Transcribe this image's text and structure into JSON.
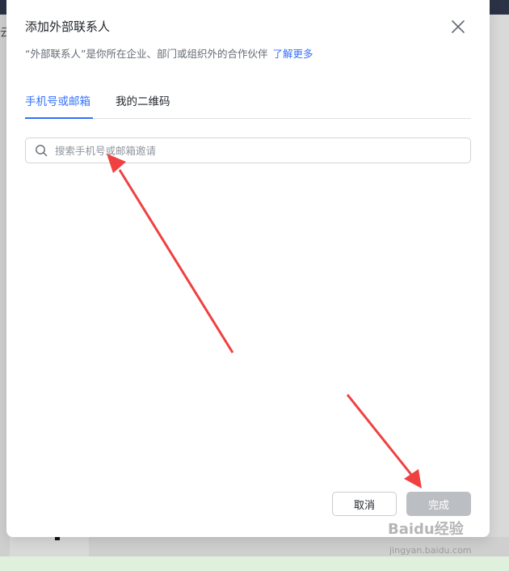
{
  "background": {
    "left_char": "云"
  },
  "dialog": {
    "title": "添加外部联系人",
    "subtitle": "“外部联系人”是你所在企业、部门或组织外的合作伙伴",
    "learn_more": "了解更多",
    "tabs": [
      {
        "label": "手机号或邮箱",
        "active": true
      },
      {
        "label": "我的二维码",
        "active": false
      }
    ],
    "search": {
      "placeholder": "搜索手机号或邮箱邀请",
      "value": ""
    },
    "buttons": {
      "cancel": "取消",
      "done": "完成"
    }
  },
  "watermark": {
    "logo": "Baidu经验",
    "url": "jingyan.baidu.com"
  },
  "colors": {
    "accent": "#3370ff",
    "arrow": "#f04040",
    "done_disabled": "#bbbfc4"
  }
}
